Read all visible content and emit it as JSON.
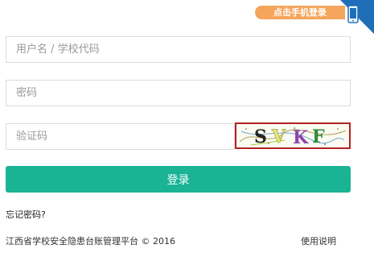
{
  "header": {
    "phone_login_label": "点击手机登录"
  },
  "form": {
    "username_placeholder": "用户名 / 学校代码",
    "password_placeholder": "密码",
    "captcha_placeholder": "验证码",
    "captcha_text": "SVKF",
    "login_label": "登录",
    "forgot_label": "忘记密码?"
  },
  "footer": {
    "copyright": "江西省学校安全隐患台账管理平台 © 2016",
    "help_label": "使用说明"
  },
  "colors": {
    "accent": "#1ab394",
    "badge": "#f5a55c",
    "corner": "#1e6fb7",
    "captcha_border": "#b22222"
  },
  "icons": {
    "phone": "mobile-phone-icon"
  }
}
